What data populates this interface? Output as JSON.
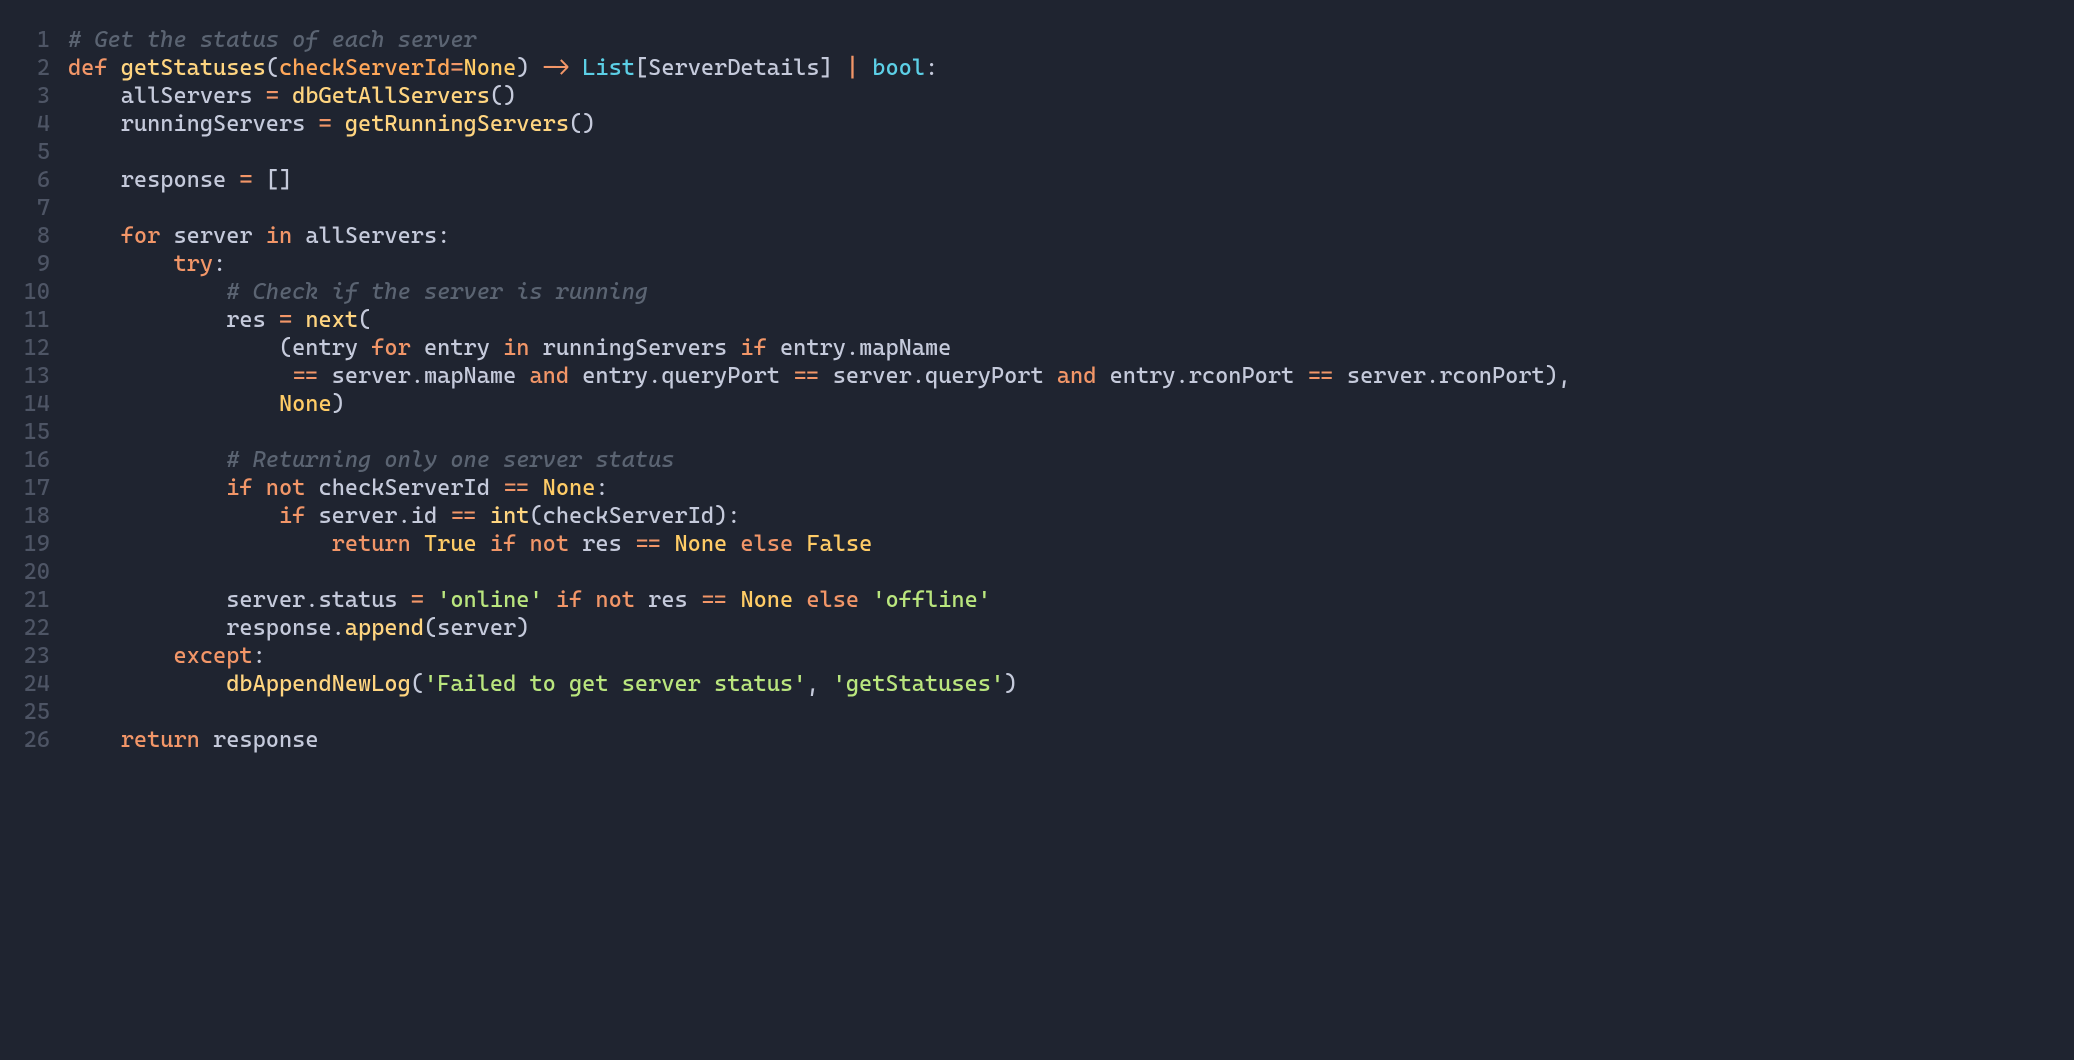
{
  "language": "python",
  "lineStart": 1,
  "lines": [
    [
      {
        "c": "cm",
        "t": "# Get the status of each server"
      }
    ],
    [
      {
        "c": "kw",
        "t": "def"
      },
      {
        "c": "id",
        "t": " "
      },
      {
        "c": "fn",
        "t": "getStatuses"
      },
      {
        "c": "pn",
        "t": "("
      },
      {
        "c": "prmA",
        "t": "checkServerId"
      },
      {
        "c": "op",
        "t": "="
      },
      {
        "c": "nn",
        "t": "None"
      },
      {
        "c": "pn",
        "t": ") "
      },
      {
        "c": "op",
        "t": "->"
      },
      {
        "c": "id",
        "t": " "
      },
      {
        "c": "ty",
        "t": "List"
      },
      {
        "c": "pn",
        "t": "["
      },
      {
        "c": "id",
        "t": "ServerDetails"
      },
      {
        "c": "pn",
        "t": "] "
      },
      {
        "c": "op",
        "t": "|"
      },
      {
        "c": "id",
        "t": " "
      },
      {
        "c": "ty",
        "t": "bool"
      },
      {
        "c": "pn",
        "t": ":"
      }
    ],
    [
      {
        "c": "id",
        "t": "    allServers "
      },
      {
        "c": "op",
        "t": "="
      },
      {
        "c": "id",
        "t": " "
      },
      {
        "c": "fn",
        "t": "dbGetAllServers"
      },
      {
        "c": "pn",
        "t": "()"
      }
    ],
    [
      {
        "c": "id",
        "t": "    runningServers "
      },
      {
        "c": "op",
        "t": "="
      },
      {
        "c": "id",
        "t": " "
      },
      {
        "c": "fn",
        "t": "getRunningServers"
      },
      {
        "c": "pn",
        "t": "()"
      }
    ],
    [
      {
        "c": "id",
        "t": ""
      }
    ],
    [
      {
        "c": "id",
        "t": "    response "
      },
      {
        "c": "op",
        "t": "="
      },
      {
        "c": "id",
        "t": " "
      },
      {
        "c": "pn",
        "t": "[]"
      }
    ],
    [
      {
        "c": "id",
        "t": ""
      }
    ],
    [
      {
        "c": "id",
        "t": "    "
      },
      {
        "c": "kw",
        "t": "for"
      },
      {
        "c": "id",
        "t": " server "
      },
      {
        "c": "kw",
        "t": "in"
      },
      {
        "c": "id",
        "t": " allServers"
      },
      {
        "c": "pn",
        "t": ":"
      }
    ],
    [
      {
        "c": "id",
        "t": "        "
      },
      {
        "c": "kw",
        "t": "try"
      },
      {
        "c": "pn",
        "t": ":"
      }
    ],
    [
      {
        "c": "id",
        "t": "            "
      },
      {
        "c": "cm",
        "t": "# Check if the server is running"
      }
    ],
    [
      {
        "c": "id",
        "t": "            res "
      },
      {
        "c": "op",
        "t": "="
      },
      {
        "c": "id",
        "t": " "
      },
      {
        "c": "fn",
        "t": "next"
      },
      {
        "c": "pn",
        "t": "("
      }
    ],
    [
      {
        "c": "id",
        "t": "                "
      },
      {
        "c": "pn",
        "t": "("
      },
      {
        "c": "id",
        "t": "entry "
      },
      {
        "c": "kw",
        "t": "for"
      },
      {
        "c": "id",
        "t": " entry "
      },
      {
        "c": "kw",
        "t": "in"
      },
      {
        "c": "id",
        "t": " runningServers "
      },
      {
        "c": "kw",
        "t": "if"
      },
      {
        "c": "id",
        "t": " entry"
      },
      {
        "c": "pn",
        "t": "."
      },
      {
        "c": "attr",
        "t": "mapName"
      }
    ],
    [
      {
        "c": "id",
        "t": "                 "
      },
      {
        "c": "op",
        "t": "=="
      },
      {
        "c": "id",
        "t": " server"
      },
      {
        "c": "pn",
        "t": "."
      },
      {
        "c": "attr",
        "t": "mapName "
      },
      {
        "c": "kw",
        "t": "and"
      },
      {
        "c": "id",
        "t": " entry"
      },
      {
        "c": "pn",
        "t": "."
      },
      {
        "c": "attr",
        "t": "queryPort "
      },
      {
        "c": "op",
        "t": "=="
      },
      {
        "c": "id",
        "t": " server"
      },
      {
        "c": "pn",
        "t": "."
      },
      {
        "c": "attr",
        "t": "queryPort "
      },
      {
        "c": "kw",
        "t": "and"
      },
      {
        "c": "id",
        "t": " entry"
      },
      {
        "c": "pn",
        "t": "."
      },
      {
        "c": "attr",
        "t": "rconPort "
      },
      {
        "c": "op",
        "t": "=="
      },
      {
        "c": "id",
        "t": " server"
      },
      {
        "c": "pn",
        "t": "."
      },
      {
        "c": "attr",
        "t": "rconPort"
      },
      {
        "c": "pn",
        "t": "),"
      }
    ],
    [
      {
        "c": "id",
        "t": "                "
      },
      {
        "c": "nn",
        "t": "None"
      },
      {
        "c": "pn",
        "t": ")"
      }
    ],
    [
      {
        "c": "id",
        "t": ""
      }
    ],
    [
      {
        "c": "id",
        "t": "            "
      },
      {
        "c": "cm",
        "t": "# Returning only one server status"
      }
    ],
    [
      {
        "c": "id",
        "t": "            "
      },
      {
        "c": "kw",
        "t": "if"
      },
      {
        "c": "id",
        "t": " "
      },
      {
        "c": "kw",
        "t": "not"
      },
      {
        "c": "id",
        "t": " checkServerId "
      },
      {
        "c": "op",
        "t": "=="
      },
      {
        "c": "id",
        "t": " "
      },
      {
        "c": "nn",
        "t": "None"
      },
      {
        "c": "pn",
        "t": ":"
      }
    ],
    [
      {
        "c": "id",
        "t": "                "
      },
      {
        "c": "kw",
        "t": "if"
      },
      {
        "c": "id",
        "t": " server"
      },
      {
        "c": "pn",
        "t": "."
      },
      {
        "c": "attr",
        "t": "id "
      },
      {
        "c": "op",
        "t": "=="
      },
      {
        "c": "id",
        "t": " "
      },
      {
        "c": "fn",
        "t": "int"
      },
      {
        "c": "pn",
        "t": "("
      },
      {
        "c": "id",
        "t": "checkServerId"
      },
      {
        "c": "pn",
        "t": "):"
      }
    ],
    [
      {
        "c": "id",
        "t": "                    "
      },
      {
        "c": "kw",
        "t": "return"
      },
      {
        "c": "id",
        "t": " "
      },
      {
        "c": "nn",
        "t": "True"
      },
      {
        "c": "id",
        "t": " "
      },
      {
        "c": "kw",
        "t": "if"
      },
      {
        "c": "id",
        "t": " "
      },
      {
        "c": "kw",
        "t": "not"
      },
      {
        "c": "id",
        "t": " res "
      },
      {
        "c": "op",
        "t": "=="
      },
      {
        "c": "id",
        "t": " "
      },
      {
        "c": "nn",
        "t": "None"
      },
      {
        "c": "id",
        "t": " "
      },
      {
        "c": "kw",
        "t": "else"
      },
      {
        "c": "id",
        "t": " "
      },
      {
        "c": "nn",
        "t": "False"
      }
    ],
    [
      {
        "c": "id",
        "t": ""
      }
    ],
    [
      {
        "c": "id",
        "t": "            server"
      },
      {
        "c": "pn",
        "t": "."
      },
      {
        "c": "attr",
        "t": "status "
      },
      {
        "c": "op",
        "t": "="
      },
      {
        "c": "id",
        "t": " "
      },
      {
        "c": "str",
        "t": "'online'"
      },
      {
        "c": "id",
        "t": " "
      },
      {
        "c": "kw",
        "t": "if"
      },
      {
        "c": "id",
        "t": " "
      },
      {
        "c": "kw",
        "t": "not"
      },
      {
        "c": "id",
        "t": " res "
      },
      {
        "c": "op",
        "t": "=="
      },
      {
        "c": "id",
        "t": " "
      },
      {
        "c": "nn",
        "t": "None"
      },
      {
        "c": "id",
        "t": " "
      },
      {
        "c": "kw",
        "t": "else"
      },
      {
        "c": "id",
        "t": " "
      },
      {
        "c": "str",
        "t": "'offline'"
      }
    ],
    [
      {
        "c": "id",
        "t": "            response"
      },
      {
        "c": "pn",
        "t": "."
      },
      {
        "c": "fn",
        "t": "append"
      },
      {
        "c": "pn",
        "t": "("
      },
      {
        "c": "id",
        "t": "server"
      },
      {
        "c": "pn",
        "t": ")"
      }
    ],
    [
      {
        "c": "id",
        "t": "        "
      },
      {
        "c": "kw",
        "t": "except"
      },
      {
        "c": "pn",
        "t": ":"
      }
    ],
    [
      {
        "c": "id",
        "t": "            "
      },
      {
        "c": "fn",
        "t": "dbAppendNewLog"
      },
      {
        "c": "pn",
        "t": "("
      },
      {
        "c": "str",
        "t": "'Failed to get server status'"
      },
      {
        "c": "pn",
        "t": ", "
      },
      {
        "c": "str",
        "t": "'getStatuses'"
      },
      {
        "c": "pn",
        "t": ")"
      }
    ],
    [
      {
        "c": "id",
        "t": ""
      }
    ],
    [
      {
        "c": "id",
        "t": "    "
      },
      {
        "c": "kw",
        "t": "return"
      },
      {
        "c": "id",
        "t": " response"
      }
    ]
  ]
}
